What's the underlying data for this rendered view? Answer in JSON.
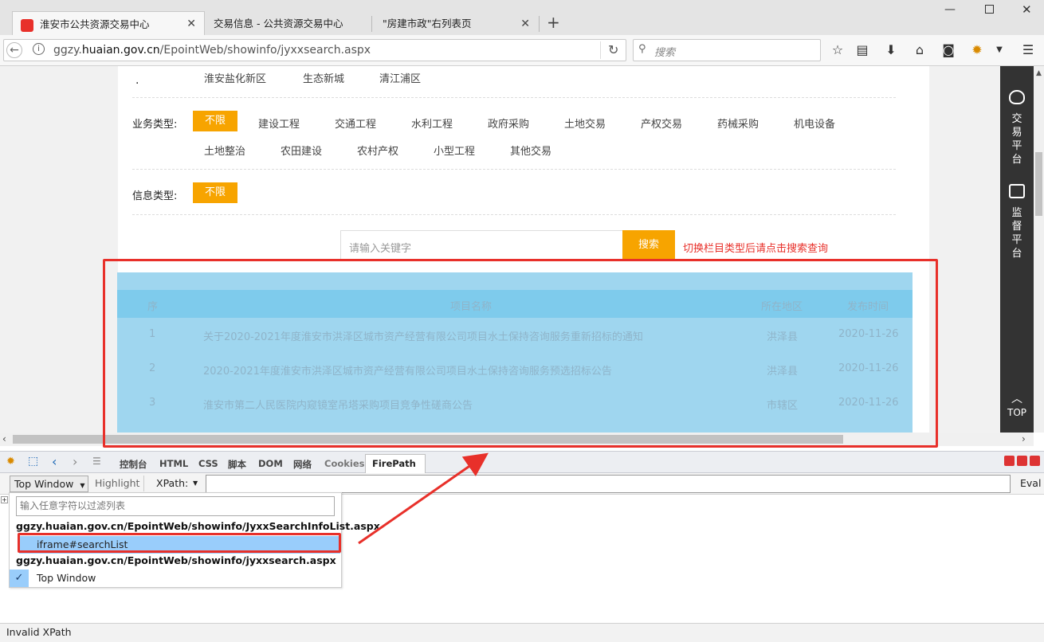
{
  "browser": {
    "tabs": [
      {
        "label": "淮安市公共资源交易中心",
        "active": true
      },
      {
        "label": "交易信息 - 公共资源交易中心",
        "active": false
      },
      {
        "label": "\"房建市政\"右列表页",
        "active": false
      }
    ],
    "new_tab_symbol": "+",
    "url_prefix": "ggzy.",
    "url_domain": "huaian.gov.cn",
    "url_path": "/EpointWeb/showinfo/jyxxsearch.aspx",
    "search_placeholder": "搜索"
  },
  "filters": {
    "region_tags": [
      "淮安盐化新区",
      "生态新城",
      "清江浦区"
    ],
    "business_label": "业务类型:",
    "business_selected": "不限",
    "business_row1": [
      "建设工程",
      "交通工程",
      "水利工程",
      "政府采购",
      "土地交易",
      "产权交易",
      "药械采购",
      "机电设备"
    ],
    "business_row2": [
      "土地整治",
      "农田建设",
      "农村产权",
      "小型工程",
      "其他交易"
    ],
    "info_label": "信息类型:",
    "info_selected": "不限"
  },
  "search": {
    "placeholder": "请输入关键字",
    "button": "搜索",
    "hint": "切换栏目类型后请点击搜索查询"
  },
  "results": {
    "headers": [
      "序",
      "项目名称",
      "所在地区",
      "发布时间"
    ],
    "rows": [
      {
        "no": "1",
        "name": "关于2020-2021年度淮安市洪泽区城市资产经营有限公司项目水土保持咨询服务重新招标的通知",
        "region": "洪泽县",
        "date": "2020-11-26"
      },
      {
        "no": "2",
        "name": "2020-2021年度淮安市洪泽区城市资产经营有限公司项目水土保持咨询服务预选招标公告",
        "region": "洪泽县",
        "date": "2020-11-26"
      },
      {
        "no": "3",
        "name": "淮安市第二人民医院内窥镜室吊塔采购项目竞争性磋商公告",
        "region": "市辖区",
        "date": "2020-11-26"
      }
    ]
  },
  "sidebar": {
    "item1": "交易平台",
    "item2": "监督平台",
    "top": "TOP"
  },
  "firebug": {
    "tabs": [
      "控制台",
      "HTML",
      "CSS",
      "脚本",
      "DOM",
      "网络",
      "Cookies"
    ],
    "active_tab": "FirePath",
    "top_window_button": "Top Window",
    "highlight": "Highlight",
    "xpath_label": "XPath:",
    "eval": "Eval",
    "dropdown": {
      "filter_placeholder": "输入任意字符以过滤列表",
      "doc1": "ggzy.huaian.gov.cn/EpointWeb/showinfo/JyxxSearchInfoList.aspx",
      "selected_item": "iframe#searchList",
      "doc2": "ggzy.huaian.gov.cn/EpointWeb/showinfo/jyxxsearch.aspx",
      "top_window": "Top Window"
    },
    "status": "Invalid XPath"
  },
  "colors": {
    "accent_orange": "#f7a400",
    "annotation_red": "#e8302a",
    "table_overlay": "#9fd6ef",
    "selected_item": "#99cdfb"
  }
}
